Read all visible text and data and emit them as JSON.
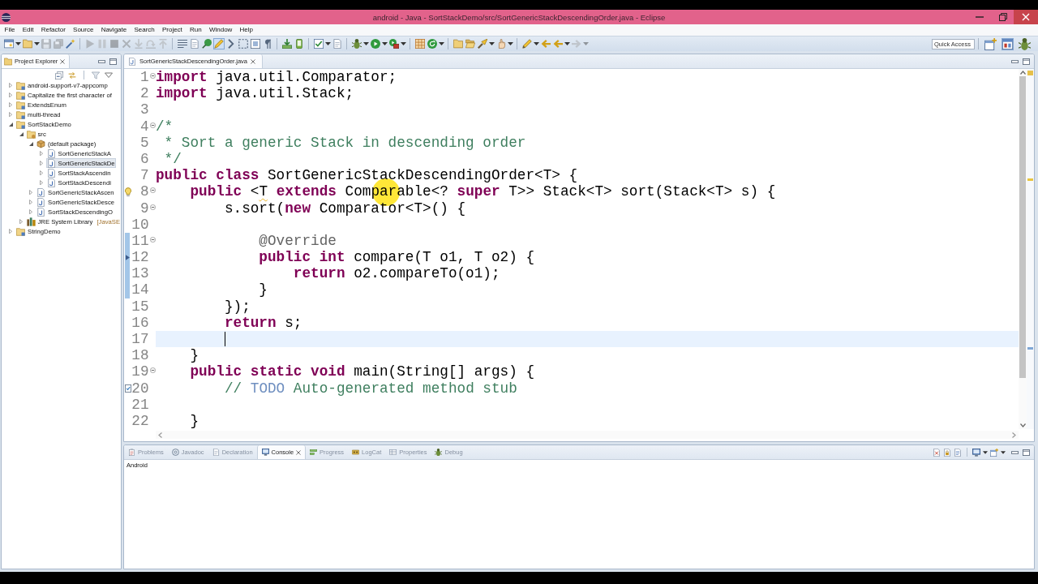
{
  "window": {
    "title": "android - Java - SortStackDemo/src/SortGenericStackDescendingOrder.java - Eclipse"
  },
  "menu": [
    "File",
    "Edit",
    "Refactor",
    "Source",
    "Navigate",
    "Search",
    "Project",
    "Run",
    "Window",
    "Help"
  ],
  "toolbar": {
    "groups": [
      [
        {
          "kind": "window",
          "disabled": false,
          "on": false
        },
        {
          "kind": "caret",
          "disabled": false,
          "on": false
        },
        {
          "kind": "folder",
          "disabled": false,
          "on": false
        },
        {
          "kind": "caret",
          "disabled": false,
          "on": false
        },
        {
          "kind": "disk",
          "disabled": true,
          "on": false
        },
        {
          "kind": "disks",
          "disabled": true,
          "on": false
        },
        {
          "kind": "wand",
          "disabled": false,
          "on": false
        }
      ],
      [
        {
          "kind": "play",
          "disabled": true,
          "on": false
        },
        {
          "kind": "pause",
          "disabled": true,
          "on": false
        },
        {
          "kind": "stop",
          "disabled": true,
          "on": false
        },
        {
          "kind": "disconnect",
          "disabled": true,
          "on": false
        },
        {
          "kind": "step-into",
          "disabled": true,
          "on": false
        },
        {
          "kind": "step-over",
          "disabled": true,
          "on": false
        },
        {
          "kind": "step-return",
          "disabled": true,
          "on": false
        }
      ],
      [
        {
          "kind": "list",
          "disabled": false,
          "on": false
        },
        {
          "kind": "document",
          "disabled": false,
          "on": false
        },
        {
          "kind": "pin",
          "disabled": false,
          "on": false
        },
        {
          "kind": "highlighter",
          "disabled": false,
          "on": true
        },
        {
          "kind": "breadcrumb",
          "disabled": false,
          "on": false
        },
        {
          "kind": "dashed-box",
          "disabled": false,
          "on": false
        },
        {
          "kind": "frame",
          "disabled": false,
          "on": false
        },
        {
          "kind": "pilcrow",
          "disabled": false,
          "on": false
        }
      ],
      [
        {
          "kind": "download",
          "disabled": false,
          "on": false
        },
        {
          "kind": "device",
          "disabled": false,
          "on": false
        }
      ],
      [
        {
          "kind": "checkbox",
          "disabled": false,
          "on": false
        },
        {
          "kind": "caret",
          "disabled": false,
          "on": false
        },
        {
          "kind": "document",
          "disabled": false,
          "on": false
        }
      ],
      [
        {
          "kind": "bug",
          "disabled": false,
          "on": false
        },
        {
          "kind": "caret",
          "disabled": false,
          "on": false
        },
        {
          "kind": "run",
          "disabled": false,
          "on": false
        },
        {
          "kind": "caret",
          "disabled": false,
          "on": false
        },
        {
          "kind": "toolbox",
          "disabled": false,
          "on": false
        },
        {
          "kind": "caret",
          "disabled": false,
          "on": false
        }
      ],
      [
        {
          "kind": "grid",
          "disabled": false,
          "on": false
        },
        {
          "kind": "refresh",
          "disabled": false,
          "on": false
        },
        {
          "kind": "caret",
          "disabled": false,
          "on": false
        }
      ],
      [
        {
          "kind": "folder",
          "disabled": false,
          "on": false
        },
        {
          "kind": "folder-open",
          "disabled": false,
          "on": false
        },
        {
          "kind": "flashlight",
          "disabled": false,
          "on": false
        },
        {
          "kind": "caret",
          "disabled": false,
          "on": false
        },
        {
          "kind": "hand",
          "disabled": false,
          "on": false
        },
        {
          "kind": "caret",
          "disabled": false,
          "on": false
        }
      ],
      [
        {
          "kind": "pencil",
          "disabled": false,
          "on": false
        },
        {
          "kind": "caret",
          "disabled": false,
          "on": false
        },
        {
          "kind": "back",
          "disabled": false,
          "on": false
        },
        {
          "kind": "back",
          "disabled": false,
          "on": false
        },
        {
          "kind": "caret",
          "disabled": false,
          "on": false
        },
        {
          "kind": "forward",
          "disabled": true,
          "on": false
        },
        {
          "kind": "caret",
          "disabled": true,
          "on": false
        }
      ]
    ],
    "quick_access": {
      "placeholder": "Quick Access"
    },
    "perspectives": [
      {
        "kind": "open",
        "selected": false
      },
      {
        "kind": "java",
        "selected": true
      },
      {
        "kind": "debug",
        "selected": false
      }
    ]
  },
  "explorer": {
    "tabs": [
      {
        "label": "Project Explorer",
        "selected": true
      }
    ],
    "toolbar": [
      [
        {
          "kind": "collapse"
        },
        {
          "kind": "link"
        }
      ],
      [
        {
          "kind": "filter"
        },
        {
          "kind": "menu"
        }
      ]
    ],
    "tree": [
      {
        "label": "android-support-v7-appcomp",
        "kind": "project",
        "expanded": false,
        "selected": false
      },
      {
        "label": "Capitalize the first character of",
        "kind": "project",
        "expanded": false,
        "selected": false
      },
      {
        "label": "ExtendsEnum",
        "kind": "project",
        "expanded": false,
        "selected": false
      },
      {
        "label": "multi-thread",
        "kind": "project",
        "expanded": false,
        "selected": false
      },
      {
        "label": "SortStackDemo",
        "kind": "project",
        "expanded": true,
        "selected": false,
        "children": [
          {
            "label": "src",
            "kind": "source-folder",
            "expanded": true,
            "selected": false,
            "children": [
              {
                "label": "(default package)",
                "kind": "package",
                "expanded": true,
                "selected": false,
                "children": [
                  {
                    "label": "SortGenericStackA",
                    "kind": "java-file",
                    "expanded": false,
                    "selected": false
                  },
                  {
                    "label": "SortGenericStackDe",
                    "kind": "java-file",
                    "expanded": false,
                    "selected": true
                  },
                  {
                    "label": "SortStackAscendin",
                    "kind": "java-file",
                    "expanded": false,
                    "selected": false
                  },
                  {
                    "label": "SortStackDescendi",
                    "kind": "java-file",
                    "expanded": false,
                    "selected": false
                  }
                ]
              },
              {
                "label": "SortGenericStackAscen",
                "kind": "java-file",
                "expanded": false,
                "selected": false
              },
              {
                "label": "SortGenericStackDesce",
                "kind": "java-file",
                "expanded": false,
                "selected": false
              },
              {
                "label": "SortStackDescendingO",
                "kind": "java-file",
                "expanded": false,
                "selected": false
              }
            ]
          },
          {
            "label": "JRE System Library",
            "decoration": "[JavaSE",
            "kind": "library",
            "expanded": false,
            "selected": false
          }
        ]
      },
      {
        "label": "StringDemo",
        "kind": "project",
        "expanded": false,
        "selected": false
      }
    ]
  },
  "editor": {
    "tabs": [
      {
        "label": "SortGenericStackDescendingOrder.java",
        "selected": true
      }
    ],
    "pointer_highlight": true,
    "lines": [
      {
        "number": "1",
        "foldable": true,
        "range": false,
        "current": false,
        "tokens": [
          {
            "kind": "keyword",
            "text": "import"
          },
          {
            "kind": "plain",
            "text": " java.util.Comparator;"
          }
        ]
      },
      {
        "number": "2",
        "foldable": false,
        "range": false,
        "current": false,
        "tokens": [
          {
            "kind": "keyword",
            "text": "import"
          },
          {
            "kind": "plain",
            "text": " java.util.Stack;"
          }
        ]
      },
      {
        "number": "3",
        "foldable": false,
        "range": false,
        "current": false
      },
      {
        "number": "4",
        "foldable": true,
        "range": false,
        "current": false,
        "tokens": [
          {
            "kind": "comment",
            "text": "/*"
          }
        ]
      },
      {
        "number": "5",
        "foldable": false,
        "range": false,
        "current": false,
        "tokens": [
          {
            "kind": "comment",
            "text": " * Sort a generic Stack in descending order"
          }
        ]
      },
      {
        "number": "6",
        "foldable": false,
        "range": false,
        "current": false,
        "tokens": [
          {
            "kind": "comment",
            "text": " */"
          }
        ]
      },
      {
        "number": "7",
        "foldable": false,
        "range": false,
        "current": false,
        "tokens": [
          {
            "kind": "keyword",
            "text": "public"
          },
          {
            "kind": "keyword",
            "text": " class"
          },
          {
            "kind": "plain",
            "text": " SortGenericStackDescendingOrder<T> {"
          }
        ]
      },
      {
        "number": "8",
        "foldable": true,
        "range": false,
        "current": false,
        "marker": {
          "kind": "warning"
        },
        "tokens": [
          {
            "kind": "keyword",
            "text": "    public"
          },
          {
            "kind": "plain",
            "text": " <"
          },
          {
            "kind": "warning",
            "text": "T"
          },
          {
            "kind": "keyword",
            "text": " extends"
          },
          {
            "kind": "plain",
            "text": " Comparable<? "
          },
          {
            "kind": "keyword",
            "text": "super"
          },
          {
            "kind": "plain",
            "text": " T>> Stack<T> sort(Stack<T> s) {"
          }
        ]
      },
      {
        "number": "9",
        "foldable": true,
        "range": false,
        "current": false,
        "tokens": [
          {
            "kind": "plain",
            "text": "        s.sort("
          },
          {
            "kind": "keyword",
            "text": "new"
          },
          {
            "kind": "plain",
            "text": " Comparator<T>() {"
          }
        ]
      },
      {
        "number": "10",
        "foldable": false,
        "range": false,
        "current": false
      },
      {
        "number": "11",
        "foldable": true,
        "range": true,
        "current": false,
        "tokens": [
          {
            "kind": "annotation",
            "text": "            @Override"
          }
        ]
      },
      {
        "number": "12",
        "foldable": false,
        "range": true,
        "current": false,
        "marker": {
          "kind": "override"
        },
        "tokens": [
          {
            "kind": "keyword",
            "text": "            public"
          },
          {
            "kind": "keyword",
            "text": " int"
          },
          {
            "kind": "plain",
            "text": " compare(T o1, T o2) {"
          }
        ]
      },
      {
        "number": "13",
        "foldable": false,
        "range": true,
        "current": false,
        "tokens": [
          {
            "kind": "keyword",
            "text": "                return"
          },
          {
            "kind": "plain",
            "text": " o2.compareTo(o1);"
          }
        ]
      },
      {
        "number": "14",
        "foldable": false,
        "range": true,
        "current": false,
        "tokens": [
          {
            "kind": "plain",
            "text": "            }"
          }
        ]
      },
      {
        "number": "15",
        "foldable": false,
        "range": false,
        "current": false,
        "tokens": [
          {
            "kind": "plain",
            "text": "        });"
          }
        ]
      },
      {
        "number": "16",
        "foldable": false,
        "range": false,
        "current": false,
        "tokens": [
          {
            "kind": "keyword",
            "text": "        return"
          },
          {
            "kind": "plain",
            "text": " s;"
          }
        ]
      },
      {
        "number": "17",
        "foldable": false,
        "range": false,
        "current": true
      },
      {
        "number": "18",
        "foldable": false,
        "range": false,
        "current": false,
        "tokens": [
          {
            "kind": "plain",
            "text": "    }"
          }
        ]
      },
      {
        "number": "19",
        "foldable": true,
        "range": false,
        "current": false,
        "tokens": [
          {
            "kind": "keyword",
            "text": "    public"
          },
          {
            "kind": "keyword",
            "text": " static"
          },
          {
            "kind": "keyword",
            "text": " void"
          },
          {
            "kind": "plain",
            "text": " main(String[] args) {"
          }
        ]
      },
      {
        "number": "20",
        "foldable": false,
        "range": false,
        "current": false,
        "marker": {
          "kind": "task"
        },
        "tokens": [
          {
            "kind": "comment",
            "text": "        // "
          },
          {
            "kind": "task",
            "text": "TODO"
          },
          {
            "kind": "comment",
            "text": " Auto-generated method stub"
          }
        ]
      },
      {
        "number": "21",
        "foldable": false,
        "range": false,
        "current": false
      },
      {
        "number": "22",
        "foldable": false,
        "range": false,
        "current": false,
        "tokens": [
          {
            "kind": "plain",
            "text": "    }"
          }
        ]
      }
    ]
  },
  "views": {
    "tabs": [
      {
        "label": "Problems",
        "kind": "problems",
        "selected": false
      },
      {
        "label": "Javadoc",
        "kind": "javadoc",
        "selected": false
      },
      {
        "label": "Declaration",
        "kind": "declaration",
        "selected": false
      },
      {
        "label": "Console",
        "kind": "console",
        "selected": true
      },
      {
        "label": "Progress",
        "kind": "progress",
        "selected": false
      },
      {
        "label": "LogCat",
        "kind": "logcat",
        "selected": false
      },
      {
        "label": "Properties",
        "kind": "properties",
        "selected": false
      },
      {
        "label": "Debug",
        "kind": "debug",
        "selected": false
      }
    ],
    "toolbar": [
      [
        {
          "kind": "clear"
        },
        {
          "kind": "scroll-lock"
        },
        {
          "kind": "word-wrap"
        }
      ],
      [
        {
          "kind": "display"
        },
        {
          "kind": "caret"
        },
        {
          "kind": "open-console"
        },
        {
          "kind": "caret"
        }
      ]
    ],
    "console": {
      "name": "Android"
    }
  }
}
